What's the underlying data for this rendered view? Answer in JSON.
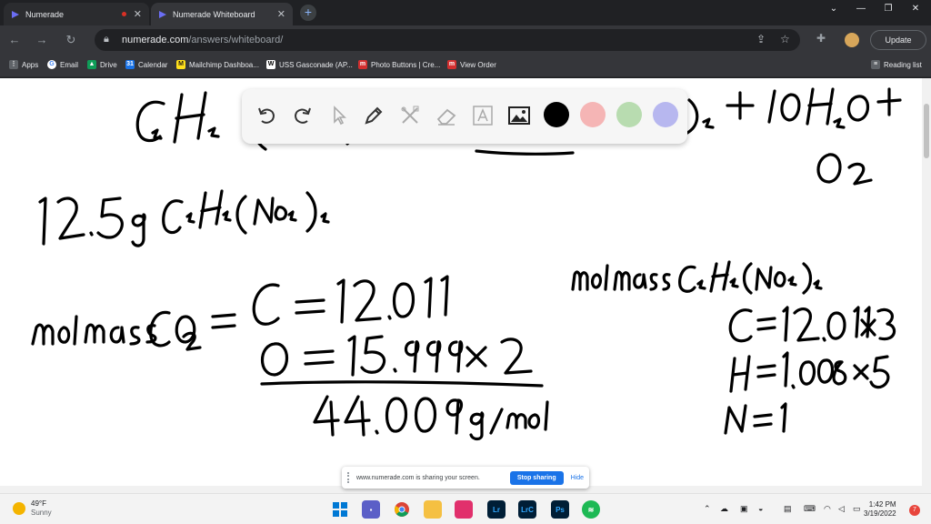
{
  "browser": {
    "tabs": [
      {
        "label": "Numerade"
      },
      {
        "label": "Numerade Whiteboard"
      }
    ],
    "new_tab": "+",
    "address": {
      "host": "numerade.com",
      "path": "/answers/whiteboard/"
    },
    "update_label": "Update"
  },
  "bookmarks": [
    {
      "label": "Apps",
      "icon": "apps-grid-icon",
      "color": "#8ab4f8"
    },
    {
      "label": "Email",
      "icon": "google-icon",
      "color": "#4285f4"
    },
    {
      "label": "Drive",
      "icon": "drive-icon",
      "color": "#0f9d58"
    },
    {
      "label": "Calendar",
      "icon": "calendar-icon",
      "color": "#1a73e8"
    },
    {
      "label": "Mailchimp Dashboa...",
      "icon": "mailchimp-icon",
      "color": "#ffe01b"
    },
    {
      "label": "USS Gasconade (AP...",
      "icon": "wiki-icon",
      "color": "#ffffff"
    },
    {
      "label": "Photo Buttons | Cre...",
      "icon": "m-icon",
      "color": "#d32f2f"
    },
    {
      "label": "View Order",
      "icon": "m-icon",
      "color": "#d32f2f"
    }
  ],
  "reading_list": "Reading list",
  "whiteboard": {
    "palette_colors": [
      "#000000",
      "#f5b5b5",
      "#b8dcb0",
      "#b7b7ef"
    ]
  },
  "sharing": {
    "message": "www.numerade.com is sharing your screen.",
    "stop_label": "Stop sharing",
    "hide_label": "Hide"
  },
  "taskbar": {
    "temperature": "49°F",
    "condition": "Sunny",
    "time": "1:42 PM",
    "date": "3/19/2022",
    "notifications": "7"
  }
}
